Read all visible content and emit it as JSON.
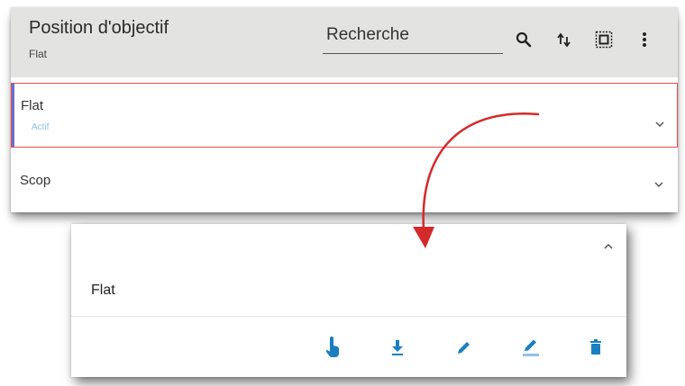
{
  "header": {
    "title": "Position d'objectif",
    "subtitle": "Flat",
    "search_placeholder": "Recherche"
  },
  "toolbar_icons": [
    "search-icon",
    "sort-icon",
    "select-all-icon",
    "more-vert-icon"
  ],
  "list": {
    "items": [
      {
        "label": "Flat",
        "status": "Actif",
        "selected": true
      },
      {
        "label": "Scop",
        "status": "",
        "selected": false
      }
    ]
  },
  "detail": {
    "label": "Flat",
    "actions": [
      "touch-icon",
      "download-icon",
      "edit-icon",
      "edit-underline-icon",
      "delete-icon"
    ]
  },
  "colors": {
    "toolbar_bg": "#e3e3e1",
    "selection_border": "#e84b4b",
    "accent_bar": "#6a6fcf",
    "action_blue": "#1a7fc1",
    "arrow_red": "#d42a2a",
    "status_text": "#8fc1ea"
  }
}
